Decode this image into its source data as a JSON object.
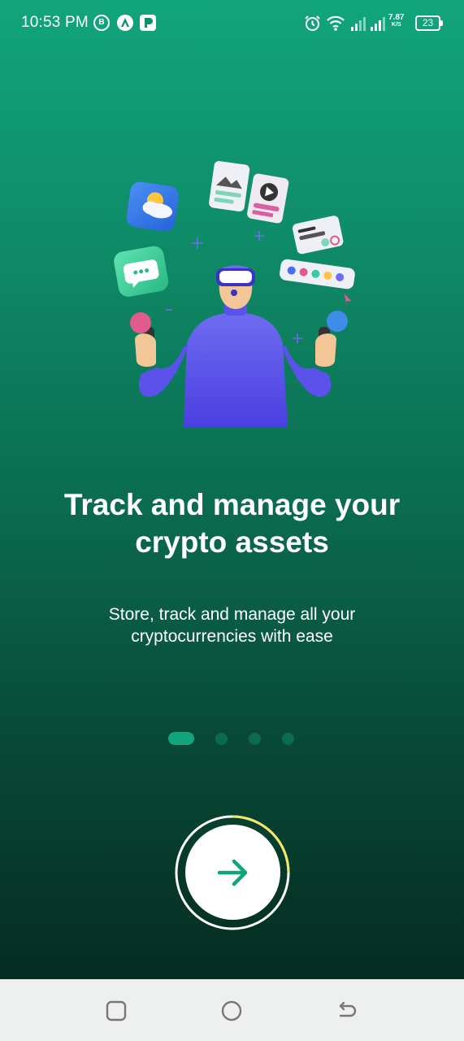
{
  "status_bar": {
    "time": "10:53 PM",
    "notif_b_letter": "B",
    "net_speed": "7.87",
    "net_speed_unit": "K/S",
    "battery": "23"
  },
  "onboarding": {
    "title": "Track and manage your crypto assets",
    "subtitle": "Store, track and manage all your cryptocurrencies with ease",
    "page_index": 1,
    "page_count": 4
  },
  "colors": {
    "gradient_top": "#11a57c",
    "gradient_bottom": "#052c21",
    "accent": "#13a47c",
    "progress_ring": "#f2e66b"
  },
  "icons": {
    "next": "arrow-right-icon",
    "nav_recent": "square-icon",
    "nav_home": "circle-icon",
    "nav_back": "back-arrow-icon"
  }
}
